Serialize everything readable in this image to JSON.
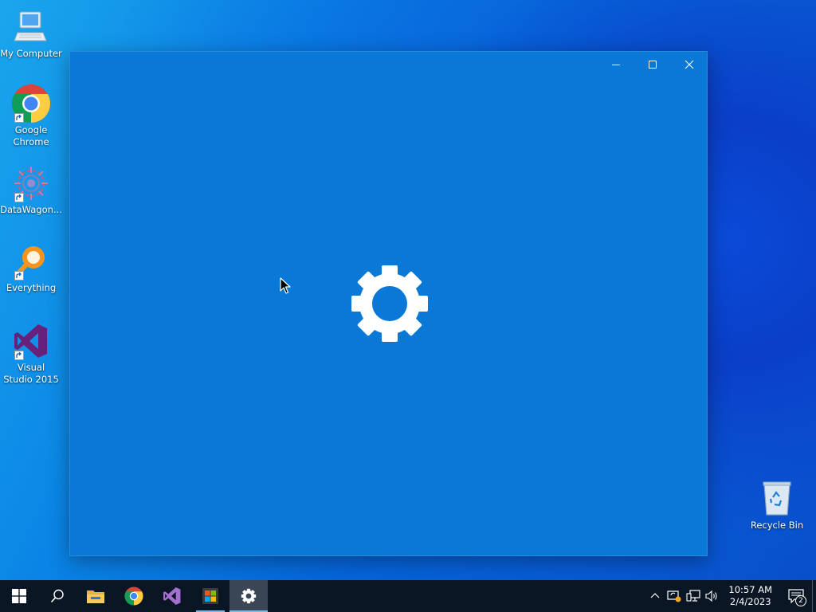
{
  "desktop": {
    "icons": [
      {
        "label": "My Computer",
        "icon": "computer-icon"
      },
      {
        "label": "Google Chrome",
        "icon": "chrome-icon"
      },
      {
        "label": "DataWagon...",
        "icon": "datawagon-icon"
      },
      {
        "label": "Everything",
        "icon": "everything-search-icon"
      },
      {
        "label": "Visual Studio 2015",
        "icon": "visual-studio-icon"
      },
      {
        "label": "Recycle Bin",
        "icon": "recycle-bin-icon"
      }
    ]
  },
  "window": {
    "app": "Settings",
    "splash_icon": "gear-icon",
    "background_color": "#0a78d6",
    "controls": [
      "minimize",
      "maximize",
      "close"
    ]
  },
  "taskbar": {
    "items": [
      "start",
      "search",
      "file-explorer",
      "chrome",
      "visual-studio",
      "microsoft-store",
      "settings"
    ],
    "active_item": "settings",
    "clock": {
      "time": "10:57 AM",
      "date": "2/4/2023"
    },
    "notifications_count": "2"
  },
  "colors": {
    "taskbar": "#0b1624",
    "accent": "#76b9ed"
  }
}
